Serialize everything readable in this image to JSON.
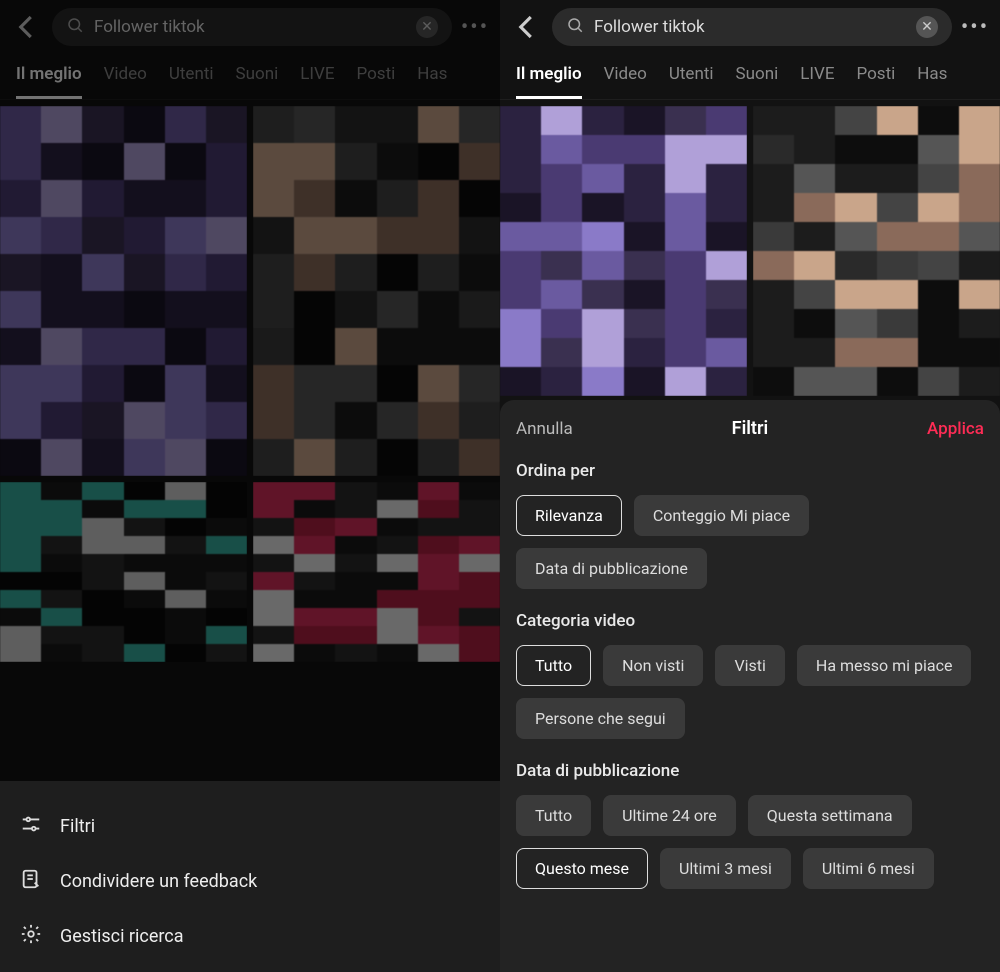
{
  "search": {
    "query": "Follower tiktok"
  },
  "tabs": [
    "Il meglio",
    "Video",
    "Utenti",
    "Suoni",
    "LIVE",
    "Posti",
    "Has"
  ],
  "left_sheet": {
    "filters": "Filtri",
    "feedback": "Condividere un feedback",
    "manage": "Gestisci ricerca"
  },
  "filter_panel": {
    "cancel": "Annulla",
    "title": "Filtri",
    "apply": "Applica",
    "sort": {
      "label": "Ordina per",
      "options": [
        "Rilevanza",
        "Conteggio Mi piace",
        "Data di pubblicazione"
      ],
      "selected": "Rilevanza"
    },
    "category": {
      "label": "Categoria video",
      "options": [
        "Tutto",
        "Non visti",
        "Visti",
        "Ha messo mi piace",
        "Persone che segui"
      ],
      "selected": "Tutto"
    },
    "date": {
      "label": "Data di pubblicazione",
      "options": [
        "Tutto",
        "Ultime 24 ore",
        "Questa settimana",
        "Questo mese",
        "Ultimi 3 mesi",
        "Ultimi 6 mesi"
      ],
      "selected": "Questo mese"
    }
  }
}
